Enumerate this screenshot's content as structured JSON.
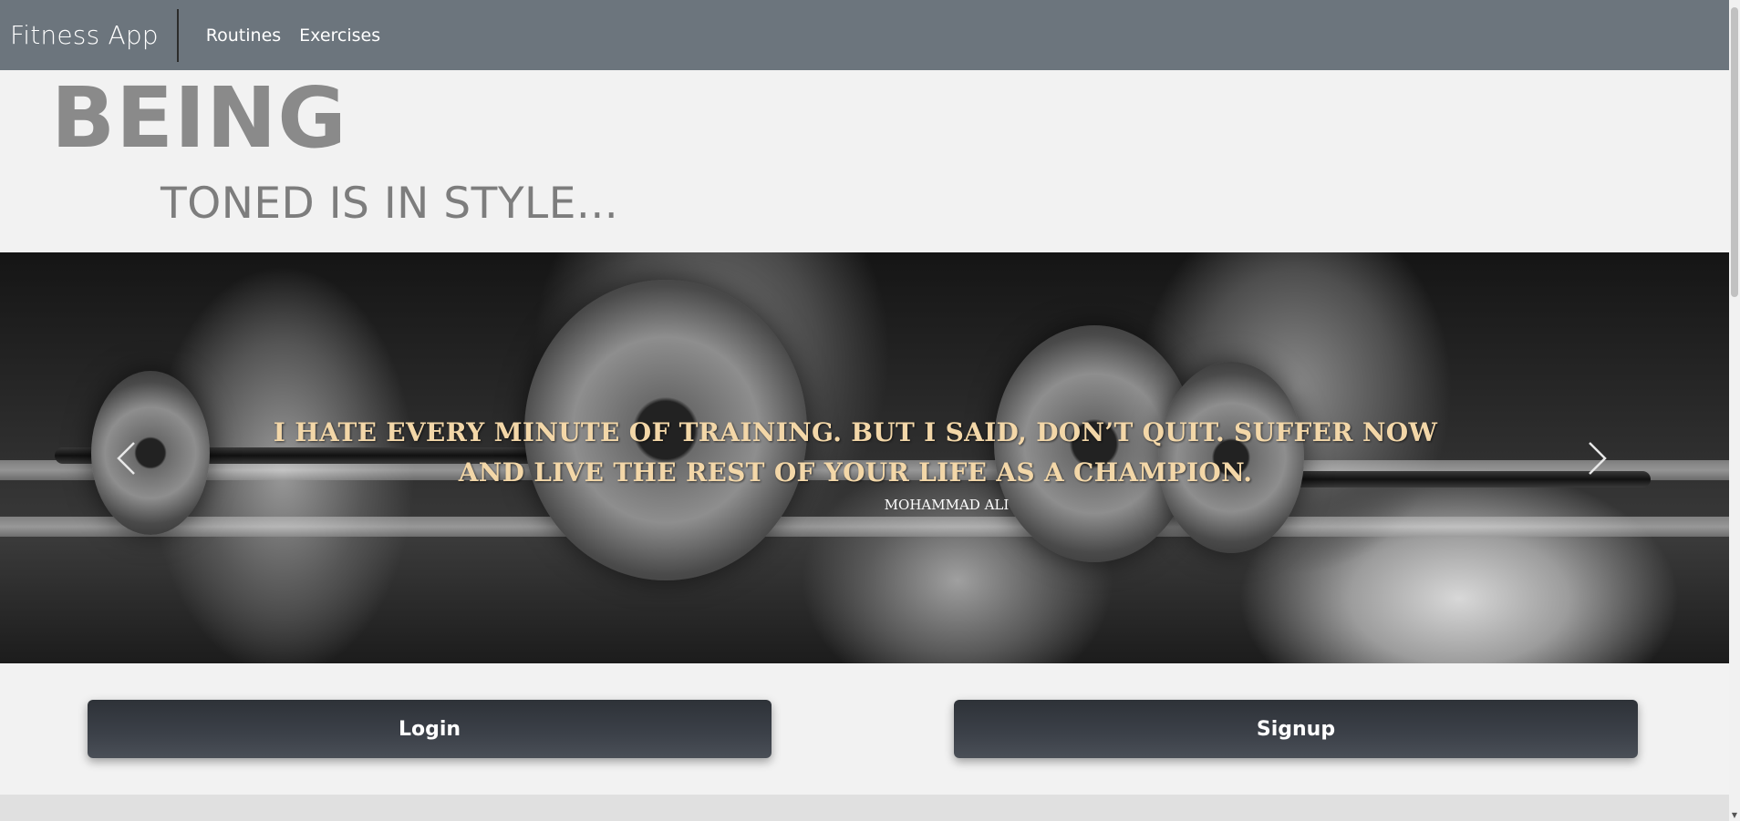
{
  "navbar": {
    "brand": "Fitness App",
    "links": [
      {
        "label": "Routines"
      },
      {
        "label": "Exercises"
      }
    ],
    "background": "#6c757d"
  },
  "hero": {
    "title": "BEING",
    "subtitle": "TONED IS IN STYLE..."
  },
  "carousel": {
    "quote": "I HATE EVERY MINUTE OF TRAINING. BUT I SAID, DON’T QUIT. SUFFER NOW AND LIVE THE REST OF YOUR LIFE AS A CHAMPION.",
    "author": "MOHAMMAD ALI",
    "prev_icon": "chevron-left-icon",
    "next_icon": "chevron-right-icon",
    "quote_color": "#f3d7a8"
  },
  "actions": {
    "login_label": "Login",
    "signup_label": "Signup"
  }
}
